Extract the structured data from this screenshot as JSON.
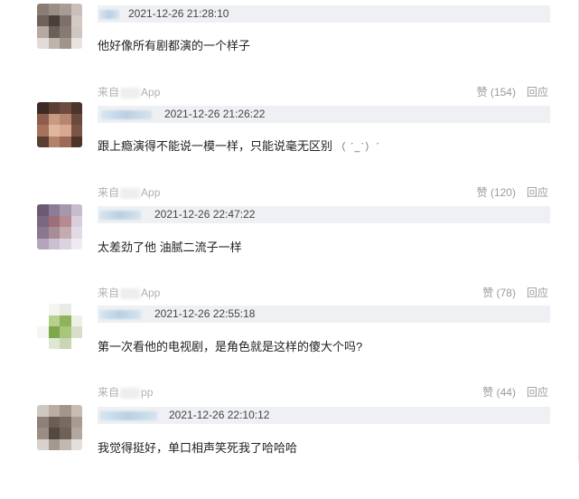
{
  "comments": [
    {
      "timestamp": "2021-12-26 21:28:10",
      "text": "他好像所有剧都演的一个样子",
      "source_prefix": "来自",
      "source_suffix": "App",
      "like_label": "赞 (154)",
      "reply_label": "回应",
      "avatar_colors": [
        "#8a7d74",
        "#9b8e86",
        "#a89c94",
        "#c9bfb8",
        "#6e625b",
        "#4a403a",
        "#7d7068",
        "#d4cac4",
        "#b7a9a0",
        "#6b5f57",
        "#877a72",
        "#cfc6c0",
        "#e2dcd8",
        "#bfb3ab",
        "#a1948c",
        "#e8e3e0"
      ]
    },
    {
      "timestamp": "2021-12-26 21:26:22",
      "text": "跟上瘾演得不能说一模一样，只能说毫无区别",
      "emoticon": "（ ˊ_ˋ）ˊ",
      "source_prefix": "来自",
      "source_suffix": "App",
      "like_label": "赞 (120)",
      "reply_label": "回应",
      "avatar_colors": [
        "#3d2a24",
        "#5a3f34",
        "#6d4b3e",
        "#4a342c",
        "#8d5e4c",
        "#c99a82",
        "#b78670",
        "#6a4a3e",
        "#a7725c",
        "#e0b79e",
        "#d8a88f",
        "#7a5546",
        "#5c3d32",
        "#b38069",
        "#9c6a56",
        "#4e3329"
      ]
    },
    {
      "timestamp": "2021-12-26 22:47:22",
      "text": "太差劲了他 油腻二流子一样",
      "source_prefix": "来自",
      "source_suffix": "App",
      "like_label": "赞 (78)",
      "reply_label": "回应",
      "avatar_colors": [
        "#6b5a73",
        "#8d7c95",
        "#a597ad",
        "#c7bccd",
        "#7a6782",
        "#9e6f78",
        "#b88a8f",
        "#d8cfdc",
        "#8a7891",
        "#a88d97",
        "#c4aab1",
        "#e2dbe6",
        "#b3a6ba",
        "#cbbfd1",
        "#ddd3e0",
        "#efeaf1"
      ]
    },
    {
      "timestamp": "2021-12-26 22:55:18",
      "text": "第一次看他的电视剧，是角色就是这样的傻大个吗?",
      "source_prefix": "来自",
      "source_suffix": "pp",
      "like_label": "赞 (44)",
      "reply_label": "回应",
      "avatar_colors": [
        "#ffffff",
        "#f3f5f0",
        "#e9ece4",
        "#ffffff",
        "#ffffff",
        "#b9cf8e",
        "#8fb35a",
        "#eef2e6",
        "#f5f6f2",
        "#7fa84a",
        "#a9c77a",
        "#d7dfcb",
        "#ffffff",
        "#dfe6d4",
        "#c9d6b3",
        "#ffffff"
      ]
    },
    {
      "timestamp": "2021-12-26 22:10:12",
      "text": "我觉得挺好，单口相声笑死我了哈哈哈",
      "avatar_colors": [
        "#cfc8c2",
        "#b9ada3",
        "#a3958a",
        "#c7bdb5",
        "#8e8078",
        "#6b5e55",
        "#776a60",
        "#a89b92",
        "#9b8d83",
        "#54483f",
        "#6e6158",
        "#b3a79e",
        "#d9d2cc",
        "#a49890",
        "#c2b8b0",
        "#e4dfdb"
      ]
    }
  ]
}
